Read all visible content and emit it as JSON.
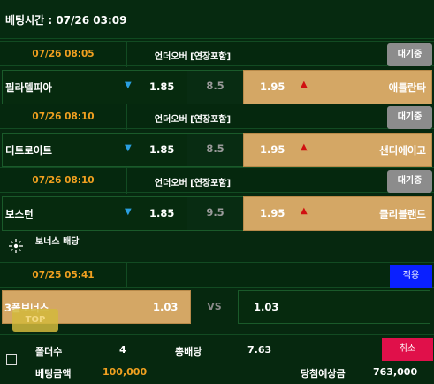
{
  "header": {
    "title": "베팅시간 : 07/26 03:09"
  },
  "matches": [
    {
      "time": "07/26 08:05",
      "market": "언더오버 [연장포함]",
      "wait_label": "대기중",
      "home": "필라델피아",
      "home_odd": "1.85",
      "line": "8.5",
      "away_odd": "1.95",
      "away": "애틀란타"
    },
    {
      "time": "07/26 08:10",
      "market": "언더오버 [연장포함]",
      "wait_label": "대기중",
      "home": "디트로이트",
      "home_odd": "1.85",
      "line": "8.5",
      "away_odd": "1.95",
      "away": "샌디에이고"
    },
    {
      "time": "07/26 08:10",
      "market": "언더오버 [연장포함]",
      "wait_label": "대기중",
      "home": "보스턴",
      "home_odd": "1.85",
      "line": "9.5",
      "away_odd": "1.95",
      "away": "클리블랜드"
    }
  ],
  "arrows": {
    "down": "▼",
    "up": "▲"
  },
  "bonus": {
    "title": "보너스 배당",
    "time": "07/25 05:41",
    "apply_label": "적용",
    "name": "3폴보너스",
    "odd_left": "1.03",
    "vs": "VS",
    "odd_right": "1.03",
    "top_label": "TOP"
  },
  "slip": {
    "folder_label": "폴더수",
    "folder_value": "4",
    "total_odds_label": "총배당",
    "total_odds_value": "7.63",
    "cancel_label": "취소",
    "bet_amount_label": "베팅금액",
    "bet_amount_value": "100,000",
    "win_label": "당첨예상금",
    "win_value": "763,000"
  },
  "colors": {
    "accent_orange": "#f0a020",
    "away_cell": "#d4a765",
    "apply_blue": "#0a20ff",
    "cancel_red": "#e0104a"
  }
}
